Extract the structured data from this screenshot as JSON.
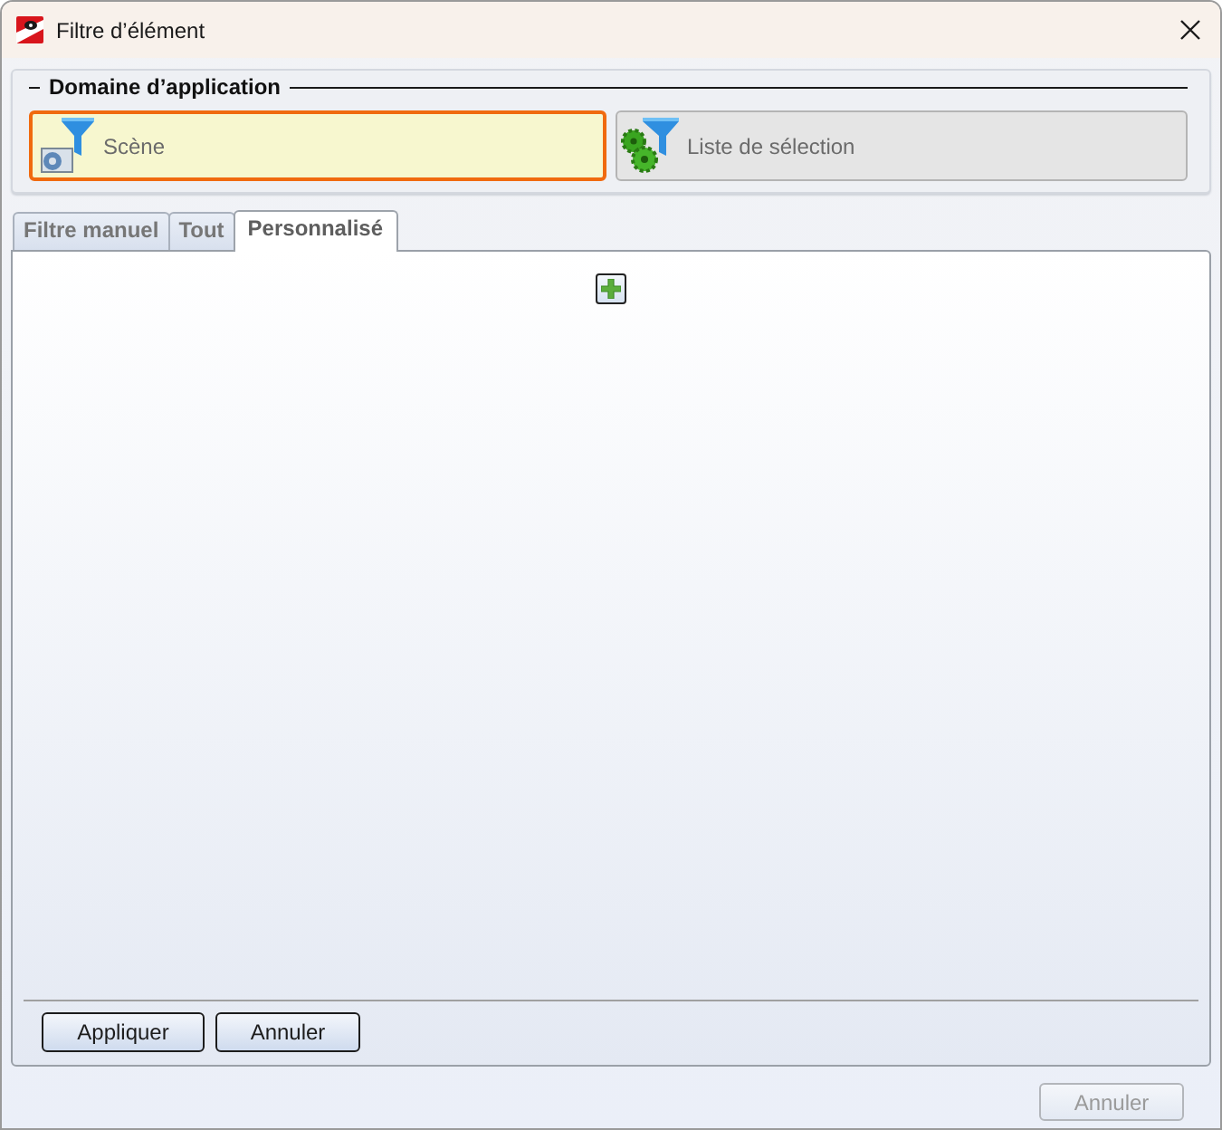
{
  "window": {
    "title": "Filtre d’élément"
  },
  "application_domain": {
    "title": "Domaine d’application",
    "options": [
      {
        "label": "Scène",
        "kind": "scene",
        "selected": true
      },
      {
        "label": "Liste de sélection",
        "kind": "selection",
        "selected": false
      }
    ]
  },
  "tabs": [
    {
      "label": "Filtre manuel",
      "selected": false
    },
    {
      "label": "Tout",
      "selected": false
    },
    {
      "label": "Personnalisé",
      "selected": true
    }
  ],
  "panel_buttons": [
    {
      "label": "Appliquer"
    },
    {
      "label": "Annuler"
    }
  ],
  "footer_buttons": [
    {
      "label": "Annuler",
      "disabled": true
    }
  ]
}
